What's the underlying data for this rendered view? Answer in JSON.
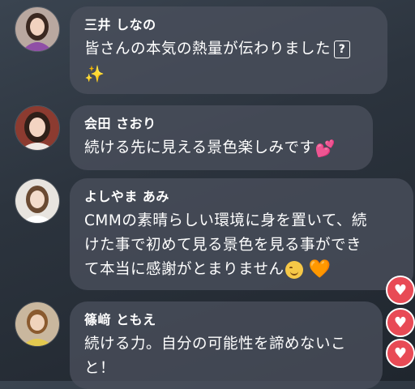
{
  "comments": [
    {
      "name": "三井 しなの",
      "lines": [
        "皆さんの本気の熱量が伝わりました"
      ],
      "unknown_glyph": "?",
      "emoji_line": "✨"
    },
    {
      "name": "会田 さおり",
      "lines": [
        "続ける先に見える景色楽しみです"
      ],
      "emoji": "💕"
    },
    {
      "name": "よしやま あみ",
      "lines": [
        "CMMの素晴らしい環境に身を置いて、続",
        "けた事で初めて見る景色を見る事ができ",
        "て本当に感謝がとまりません"
      ],
      "emoji_orange": "🧡"
    },
    {
      "name": "篠﨑 ともえ",
      "lines": [
        "続ける力。自分の可能性を諦めないこ",
        "と！"
      ]
    }
  ],
  "reaction_icon": "heart-reaction-icon",
  "reaction_glyph": "♥"
}
